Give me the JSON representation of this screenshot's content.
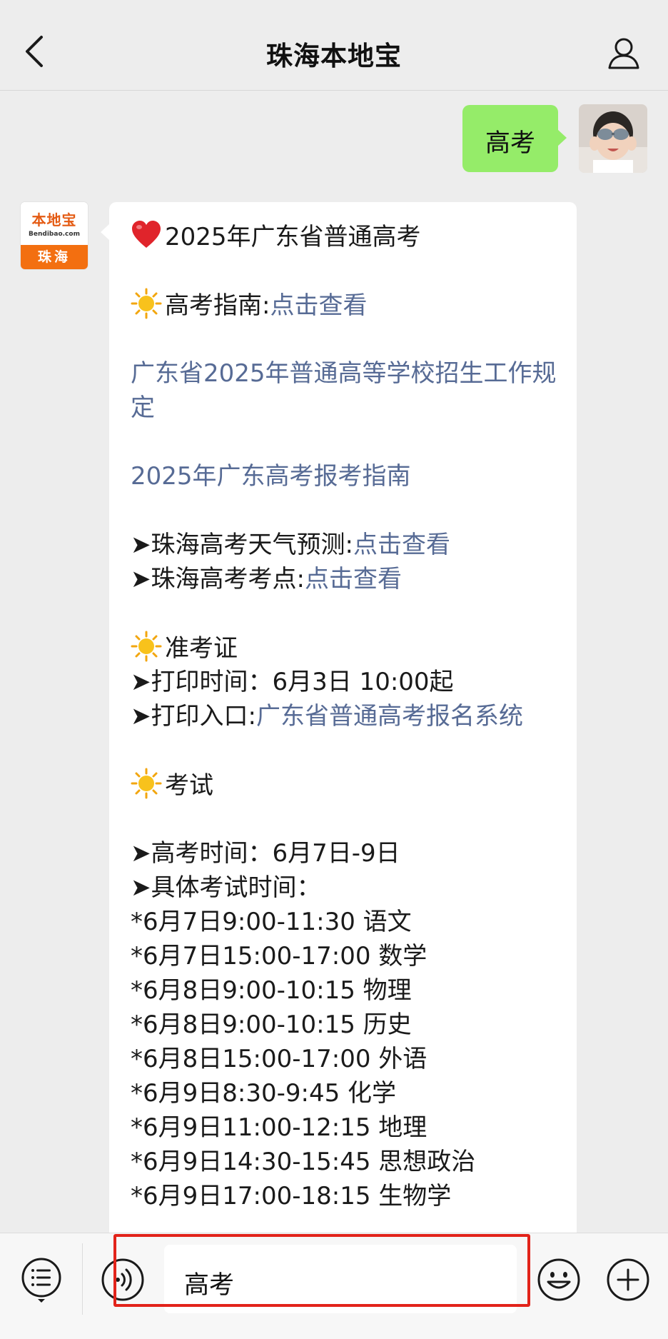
{
  "header": {
    "title": "珠海本地宝",
    "back_icon": "chevron-left-icon",
    "profile_icon": "person-icon"
  },
  "outgoing_message": {
    "text": "高考",
    "bubble_color": "#95ec69"
  },
  "incoming_message": {
    "avatar": {
      "logo_main": "本地宝",
      "logo_sub": "Bendibao.com",
      "logo_city": "珠海"
    },
    "lines": {
      "title": "2025年广东省普通高考",
      "guide_label": "高考指南:",
      "guide_link": "点击查看",
      "rules_link": "广东省2025年普通高等学校招生工作规定",
      "registration_link": "2025年广东高考报考指南",
      "weather_label": "➤珠海高考天气预测:",
      "weather_link": "点击查看",
      "venue_label": "➤珠海高考考点:",
      "venue_link": "点击查看",
      "ticket_heading": "准考证",
      "print_time": "➤打印时间：6月3日 10:00起",
      "print_entry_label": "➤打印入口:",
      "print_entry_link": "广东省普通高考报名系统",
      "exam_heading": "考试",
      "exam_dates": "➤高考时间：6月7日-9日",
      "schedule_heading": "➤具体考试时间：",
      "schedule": [
        "*6月7日9:00-11:30 语文",
        "*6月7日15:00-17:00 数学",
        "*6月8日9:00-10:15 物理",
        "*6月8日9:00-10:15 历史",
        "*6月8日15:00-17:00 外语",
        "*6月9日8:30-9:45 化学",
        "*6月9日11:00-12:15 地理",
        "*6月9日14:30-15:45 思想政治",
        "*6月9日17:00-18:15 生物学"
      ]
    },
    "link_color": "#576b95"
  },
  "input_bar": {
    "menu_icon": "menu-list-icon",
    "voice_icon": "voice-icon",
    "input_value": "高考",
    "emoji_icon": "smiley-icon",
    "plus_icon": "plus-icon",
    "highlight_color": "#e2231a"
  }
}
